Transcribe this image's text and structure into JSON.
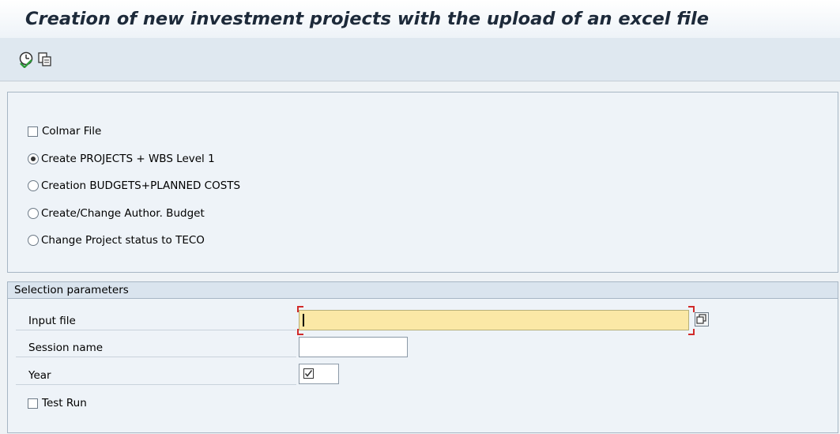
{
  "title": "Creation of new investment projects with the upload of an excel file",
  "toolbar": {
    "items": [
      {
        "icon": "execute-icon"
      },
      {
        "icon": "copy-variant-icon"
      }
    ]
  },
  "options": {
    "colmar_file": {
      "label": "Colmar File",
      "checked": false
    },
    "radios": [
      {
        "label": "Create PROJECTS + WBS Level 1",
        "selected": true
      },
      {
        "label": "Creation BUDGETS+PLANNED COSTS",
        "selected": false
      },
      {
        "label": "Create/Change Author. Budget",
        "selected": false
      },
      {
        "label": "Change Project status to TECO",
        "selected": false
      }
    ]
  },
  "selection": {
    "header": "Selection parameters",
    "input_file": {
      "label": "Input file",
      "value": ""
    },
    "session_name": {
      "label": "Session name",
      "value": ""
    },
    "year": {
      "label": "Year",
      "value": ""
    },
    "test_run": {
      "label": "Test Run",
      "checked": false
    }
  },
  "colors": {
    "required_field": "#fbe8a6",
    "required_marker": "#d12a2a",
    "toolbar_bg": "#dfe8f0"
  }
}
